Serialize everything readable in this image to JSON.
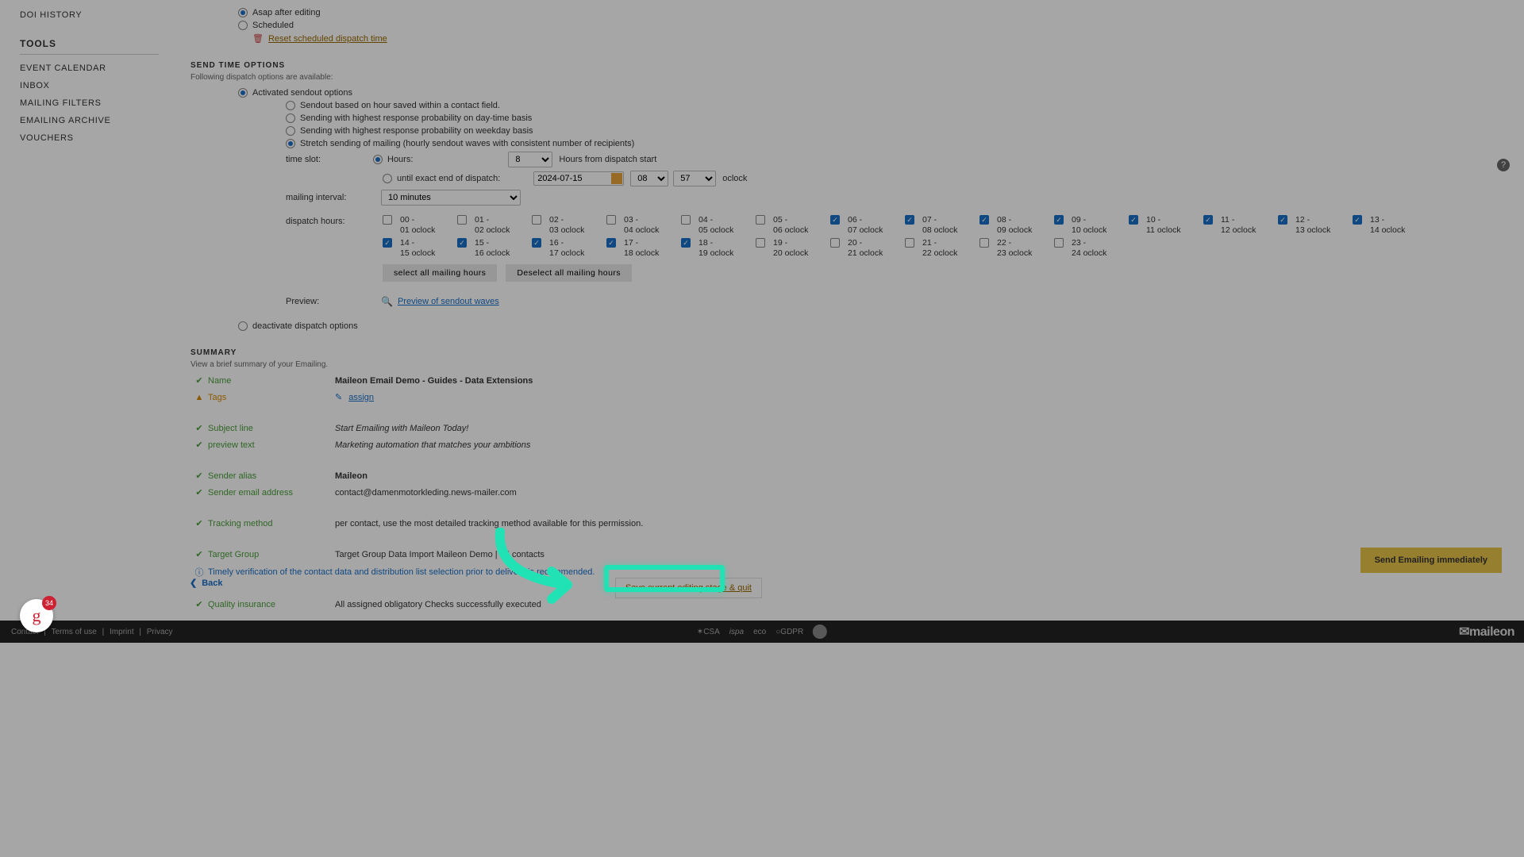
{
  "sidebar": {
    "doi_history": "DOI HISTORY",
    "tools_header": "TOOLS",
    "tools": [
      "EVENT CALENDAR",
      "INBOX",
      "MAILING FILTERS",
      "EMAILING ARCHIVE",
      "VOUCHERS"
    ]
  },
  "dispatch": {
    "asap": "Asap after editing",
    "scheduled": "Scheduled",
    "reset": "Reset scheduled dispatch time"
  },
  "sendtime": {
    "header": "SEND TIME OPTIONS",
    "sub": "Following dispatch options are available:",
    "activated": "Activated sendout options",
    "opt_hour": "Sendout based on hour saved within a contact field.",
    "opt_daytime": "Sending with highest response probability on day-time basis",
    "opt_weekday": "Sending with highest response probability on weekday basis",
    "opt_stretch": "Stretch sending of mailing (hourly sendout waves with consistent number of recipients)",
    "time_slot": "time slot:",
    "hours_lbl": "Hours:",
    "hours_val": "8",
    "hours_from": "Hours from dispatch start",
    "until": "until exact end of dispatch:",
    "date": "2024-07-15",
    "hh": "08",
    "mm": "57",
    "oclock": "oclock",
    "interval_lbl": "mailing interval:",
    "interval_val": "10 minutes",
    "dispatch_hours": "dispatch hours:",
    "select_all": "select all mailing hours",
    "deselect_all": "Deselect all mailing hours",
    "preview_lbl": "Preview:",
    "preview_link": "Preview of sendout waves",
    "deactivate": "deactivate dispatch options"
  },
  "hours": [
    {
      "l": "00 - 01 oclock",
      "c": false
    },
    {
      "l": "01 - 02 oclock",
      "c": false
    },
    {
      "l": "02 - 03 oclock",
      "c": false
    },
    {
      "l": "03 - 04 oclock",
      "c": false
    },
    {
      "l": "04 - 05 oclock",
      "c": false
    },
    {
      "l": "05 - 06 oclock",
      "c": false
    },
    {
      "l": "06 - 07 oclock",
      "c": true
    },
    {
      "l": "07 - 08 oclock",
      "c": true
    },
    {
      "l": "08 - 09 oclock",
      "c": true
    },
    {
      "l": "09 - 10 oclock",
      "c": true
    },
    {
      "l": "10 - 11 oclock",
      "c": true
    },
    {
      "l": "11 - 12 oclock",
      "c": true
    },
    {
      "l": "12 - 13 oclock",
      "c": true
    },
    {
      "l": "13 - 14 oclock",
      "c": true
    },
    {
      "l": "14 - 15 oclock",
      "c": true
    },
    {
      "l": "15 - 16 oclock",
      "c": true
    },
    {
      "l": "16 - 17 oclock",
      "c": true
    },
    {
      "l": "17 - 18 oclock",
      "c": true
    },
    {
      "l": "18 - 19 oclock",
      "c": true
    },
    {
      "l": "19 - 20 oclock",
      "c": false
    },
    {
      "l": "20 - 21 oclock",
      "c": false
    },
    {
      "l": "21 - 22 oclock",
      "c": false
    },
    {
      "l": "22 - 23 oclock",
      "c": false
    },
    {
      "l": "23 - 24 oclock",
      "c": false
    }
  ],
  "summary": {
    "header": "SUMMARY",
    "sub": "View a brief summary of your Emailing.",
    "name_l": "Name",
    "name_v": "Maileon Email Demo - Guides - Data Extensions",
    "tags_l": "Tags",
    "tags_v": "assign",
    "subj_l": "Subject line",
    "subj_v": "Start Emailing with Maileon Today!",
    "prev_l": "preview text",
    "prev_v": "Marketing automation that matches your ambitions",
    "alias_l": "Sender alias",
    "alias_v": "Maileon",
    "email_l": "Sender email address",
    "email_v": "contact@damenmotorkleding.news-mailer.com",
    "track_l": "Tracking method",
    "track_v": "per contact, use the most detailed tracking method available for this permission.",
    "tg_l": "Target Group",
    "tg_v": "Target Group Data Import Maileon Demo | 25 contacts",
    "verify": "Timely verification of the contact data and distribution list selection prior to delivery is recommended.",
    "qi_l": "Quality insurance",
    "qi_v": "All assigned obligatory Checks successfully executed"
  },
  "buttons": {
    "send": "Send Emailing immediately",
    "save": "Save current editing stage & quit",
    "back": "Back"
  },
  "footer": {
    "contact": "Contact",
    "terms": "Terms of use",
    "imprint": "Imprint",
    "privacy": "Privacy",
    "csa": "CSA",
    "ispa": "ispa",
    "eco": "eco",
    "gdpr": "GDPR",
    "brand": "✉maileon"
  },
  "badge_count": "34"
}
